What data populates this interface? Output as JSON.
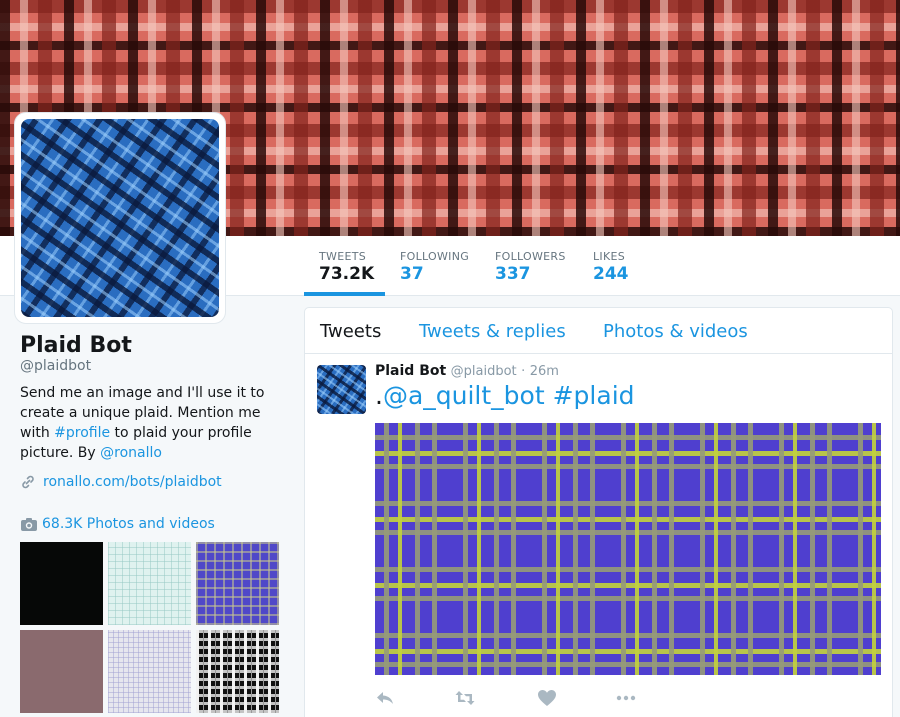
{
  "profile": {
    "name": "Plaid Bot",
    "handle": "@plaidbot",
    "bio": {
      "part1": "Send me an image and I'll use it to create a unique plaid. Mention me with ",
      "hashtag": "#profile",
      "part2": " to plaid your profile picture. By ",
      "mention": "@ronallo"
    },
    "url": "ronallo.com/bots/plaidbot",
    "photos_link": "68.3K Photos and videos"
  },
  "stats": [
    {
      "label": "TWEETS",
      "value": "73.2K"
    },
    {
      "label": "FOLLOWING",
      "value": "37"
    },
    {
      "label": "FOLLOWERS",
      "value": "337"
    },
    {
      "label": "LIKES",
      "value": "244"
    }
  ],
  "tabs": [
    "Tweets",
    "Tweets & replies",
    "Photos & videos"
  ],
  "tweet": {
    "name": "Plaid Bot",
    "handle": "@plaidbot",
    "separator": "·",
    "time": "26m",
    "text_prefix": ".",
    "mention": "@a_quilt_bot",
    "hashtag": "#plaid"
  },
  "icons": {
    "link": "link-icon",
    "camera": "camera-icon",
    "reply": "reply-icon",
    "retweet": "retweet-icon",
    "like": "heart-icon",
    "more": "more-icon"
  },
  "colors": {
    "accent": "#1b95e0",
    "text": "#14171a",
    "muted": "#66757f",
    "background": "#f5f8fa"
  }
}
